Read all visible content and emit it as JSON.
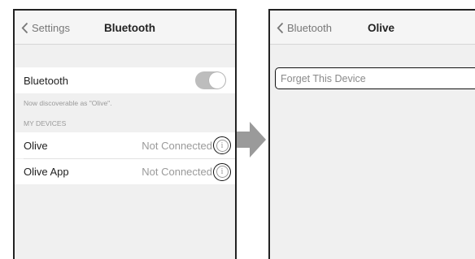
{
  "left_screen": {
    "back_label": "Settings",
    "title": "Bluetooth",
    "bluetooth_label": "Bluetooth",
    "discoverable_text": "Now discoverable as \"Olive\".",
    "section_header": "MY DEVICES",
    "devices": [
      {
        "name": "Olive",
        "status": "Not Connected",
        "info_icon": "i"
      },
      {
        "name": "Olive App",
        "status": "Not Connected",
        "info_icon": "i"
      }
    ],
    "bluetooth_on": true
  },
  "right_screen": {
    "back_label": "Bluetooth",
    "title": "Olive",
    "forget_label": "Forget This Device"
  },
  "colors": {
    "arrow": "#9a9a9a",
    "highlight_outline": "#111111",
    "toggle": "#bdbdbd"
  }
}
